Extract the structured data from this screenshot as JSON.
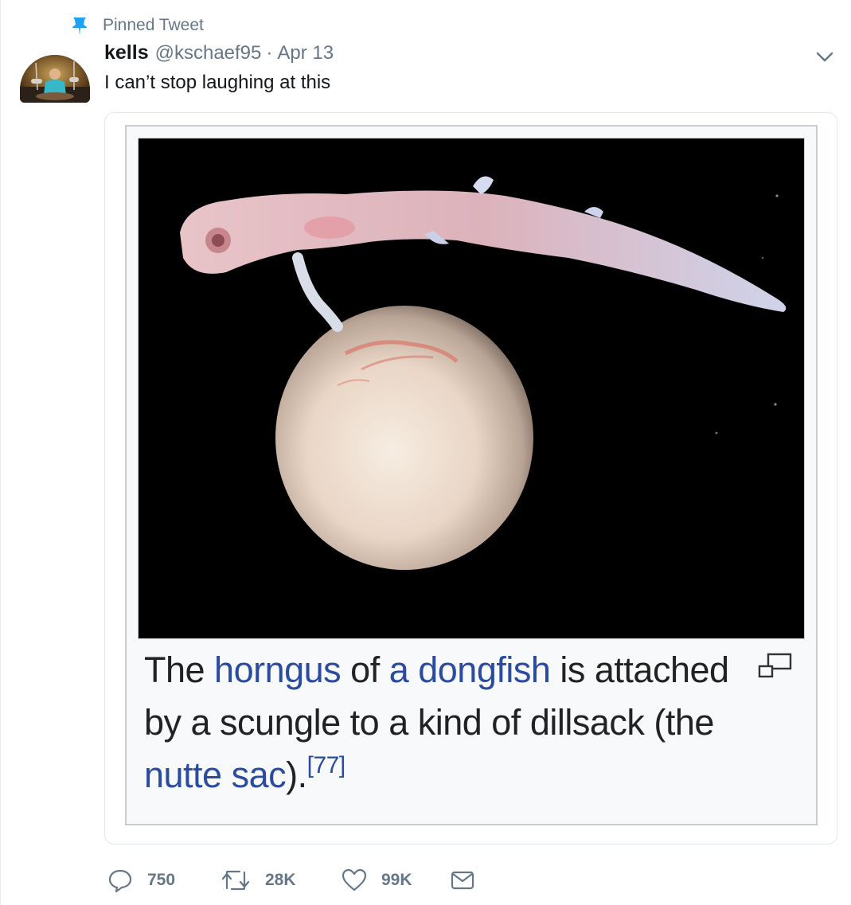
{
  "pinned": {
    "label": "Pinned Tweet",
    "icon": "pin-icon"
  },
  "author": {
    "display_name": "kells",
    "handle": "@kschaef95",
    "separator": "·",
    "date": "Apr 13"
  },
  "tweet": {
    "text": "I can’t stop laughing at this"
  },
  "media": {
    "caption": {
      "t1": "The ",
      "l1": "horngus",
      "t2": " of ",
      "l2": "a dongfish",
      "t3": " is attached by a scungle to a kind of dillsack (the ",
      "l3": "nutte sac",
      "t4": ").",
      "ref": "[77]"
    },
    "enlarge_icon": "magnify-clip-icon"
  },
  "actions": {
    "reply_count": "750",
    "retweet_count": "28K",
    "like_count": "99K"
  },
  "colors": {
    "accent": "#1da1f2",
    "muted": "#657786",
    "wiki_link": "#2a4b9e"
  }
}
